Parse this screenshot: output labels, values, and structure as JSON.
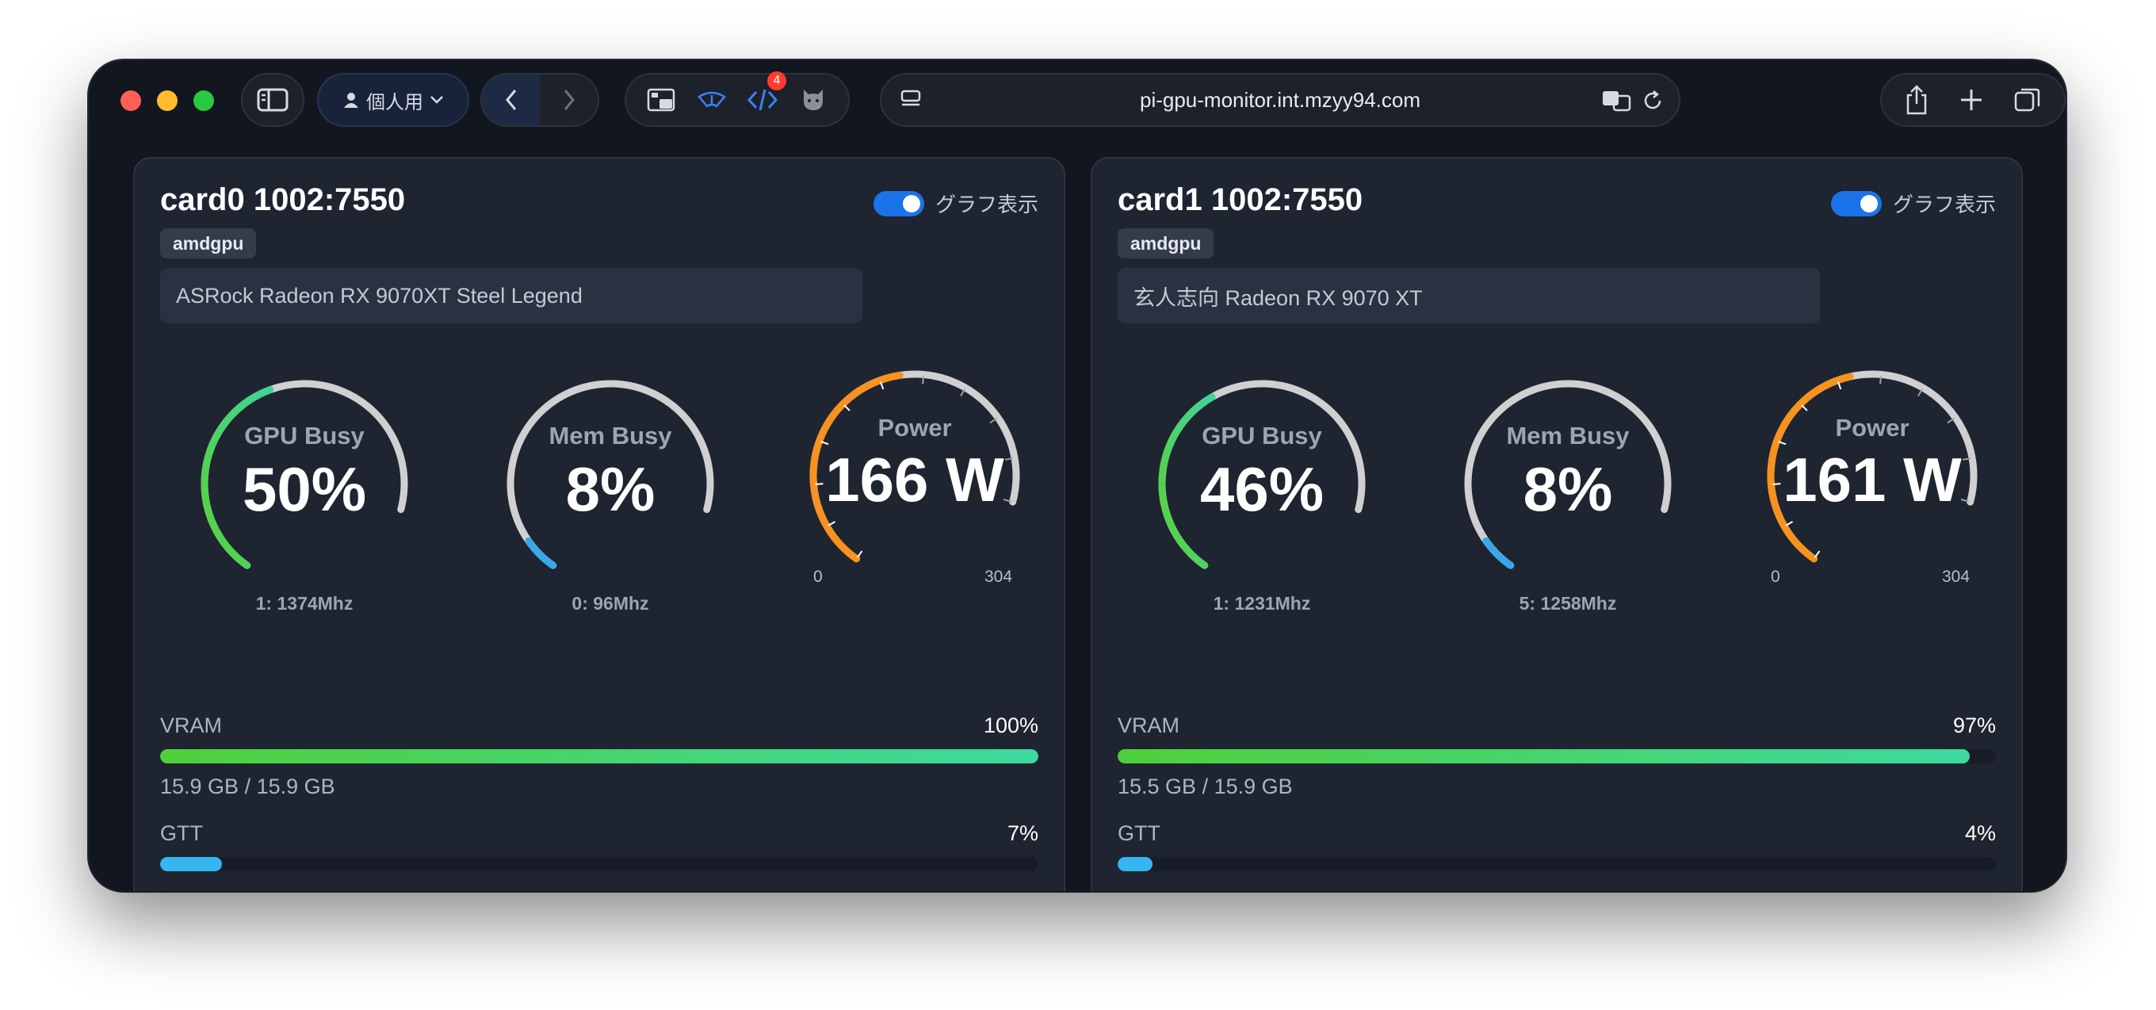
{
  "browser": {
    "profile_label": "個人用",
    "url": "pi-gpu-monitor.int.mzyy94.com",
    "extension_badge": "4"
  },
  "cards": [
    {
      "title": "card0 1002:7550",
      "toggle_label": "グラフ表示",
      "driver": "amdgpu",
      "model": "ASRock Radeon RX 9070XT Steel Legend",
      "gpu_busy": {
        "label": "GPU Busy",
        "value_text": "50%",
        "percent": 50,
        "clock": "1: 1374Mhz"
      },
      "mem_busy": {
        "label": "Mem Busy",
        "value_text": "8%",
        "percent": 8,
        "clock": "0: 96Mhz"
      },
      "power": {
        "label": "Power",
        "value_text": "166 W",
        "watts": 166,
        "min": "0",
        "max": "304"
      },
      "vram": {
        "label": "VRAM",
        "percent_text": "100%",
        "percent": 100,
        "usage": "15.9 GB / 15.9 GB"
      },
      "gtt": {
        "label": "GTT",
        "percent_text": "7%",
        "percent": 7
      }
    },
    {
      "title": "card1 1002:7550",
      "toggle_label": "グラフ表示",
      "driver": "amdgpu",
      "model": "玄人志向 Radeon RX 9070 XT",
      "gpu_busy": {
        "label": "GPU Busy",
        "value_text": "46%",
        "percent": 46,
        "clock": "1: 1231Mhz"
      },
      "mem_busy": {
        "label": "Mem Busy",
        "value_text": "8%",
        "percent": 8,
        "clock": "5: 1258Mhz"
      },
      "power": {
        "label": "Power",
        "value_text": "161 W",
        "watts": 161,
        "min": "0",
        "max": "304"
      },
      "vram": {
        "label": "VRAM",
        "percent_text": "97%",
        "percent": 97,
        "usage": "15.5 GB / 15.9 GB"
      },
      "gtt": {
        "label": "GTT",
        "percent_text": "4%",
        "percent": 4
      }
    }
  ],
  "colors": {
    "gauge_track": "#d0d0d0",
    "gpu_arc_start": "#5ad13a",
    "gpu_arc_end": "#3ed598",
    "mem_arc": "#3aa8e8",
    "power_arc": "#f7921e",
    "accent": "#1a73e8"
  }
}
